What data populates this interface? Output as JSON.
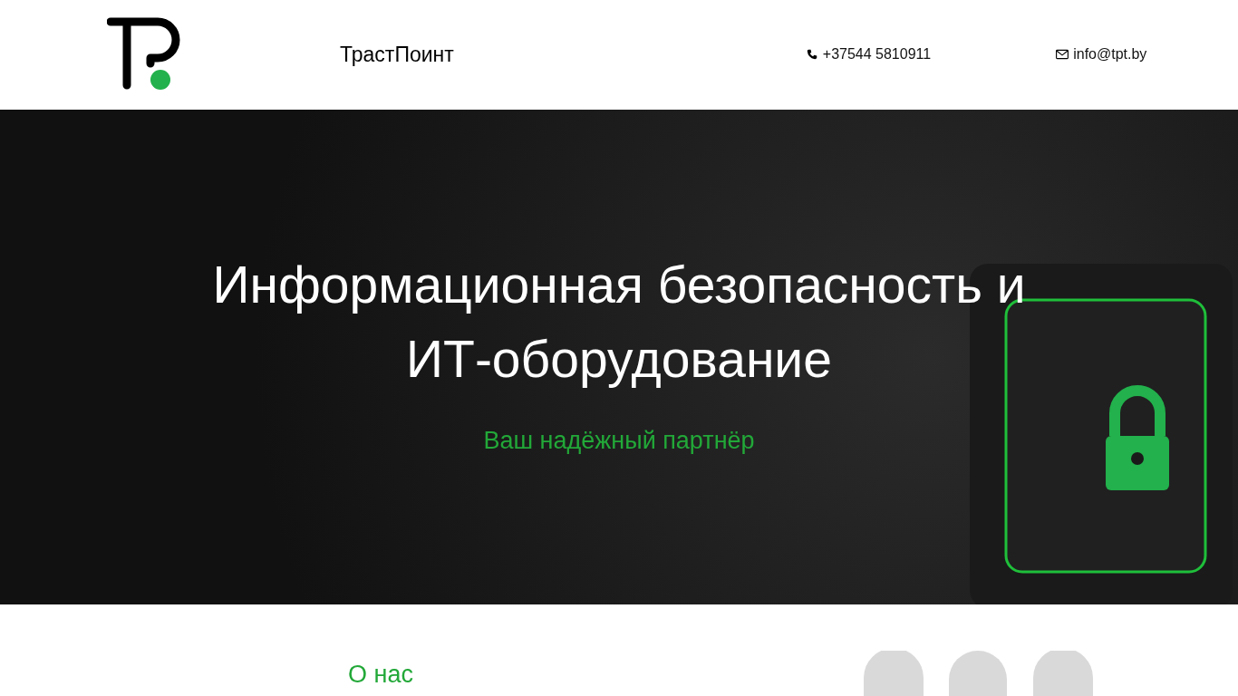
{
  "header": {
    "brand": "ТрастПоинт",
    "phone": "+37544 5810911",
    "email": "info@tpt.by"
  },
  "hero": {
    "title": "Информационная безопасность и ИТ-оборудование",
    "subtitle": "Ваш надёжный партнёр"
  },
  "about": {
    "heading": "О нас"
  }
}
